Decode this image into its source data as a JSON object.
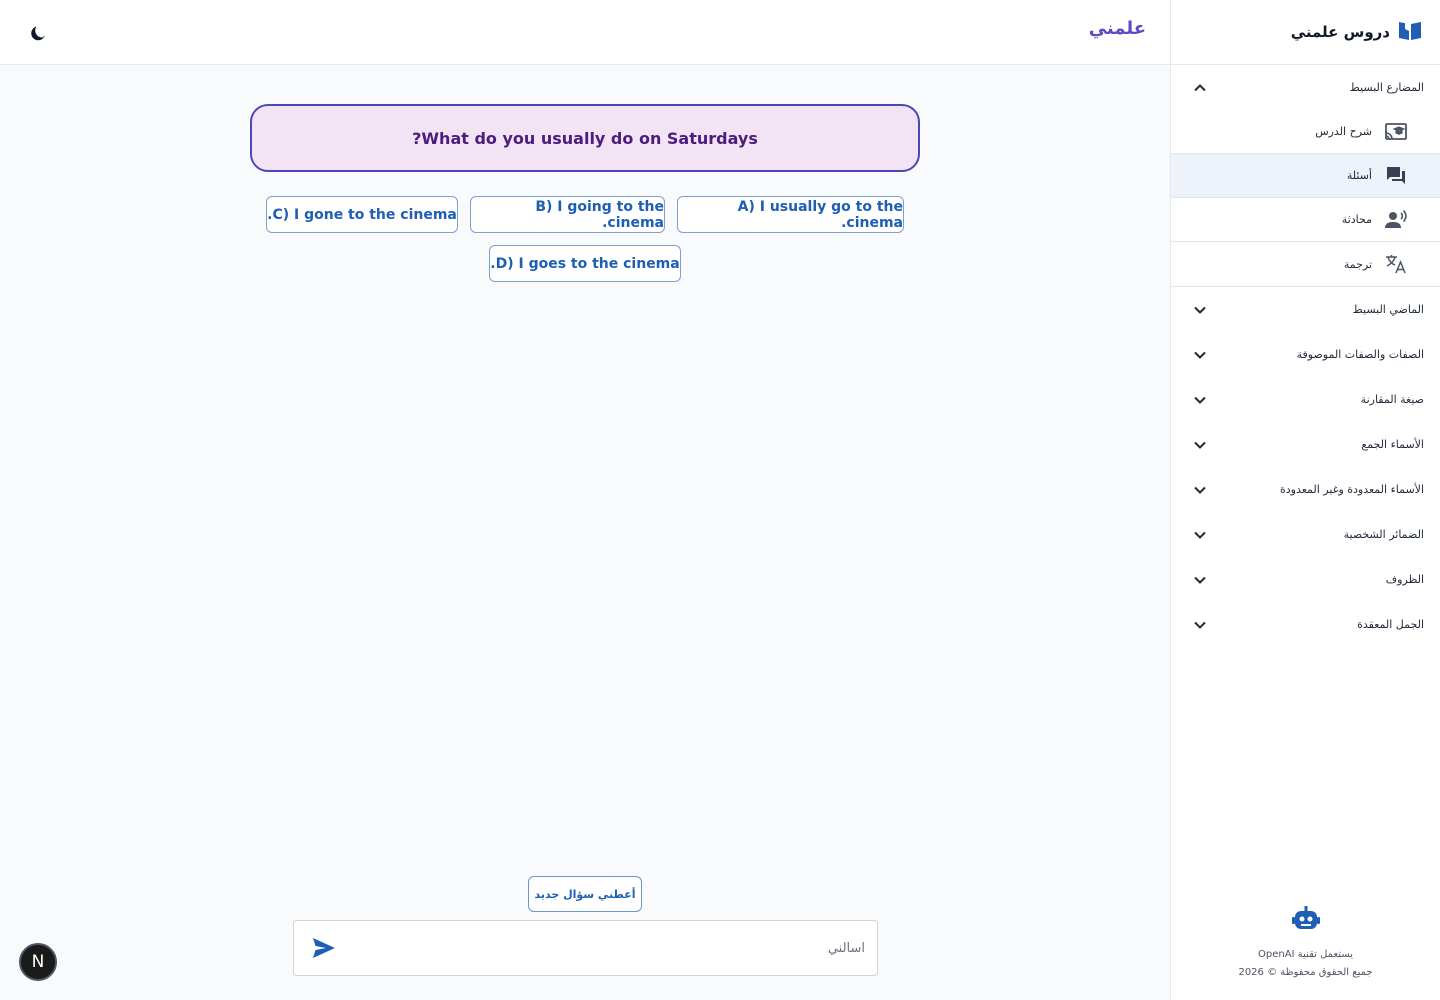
{
  "header": {
    "logo": "علمني",
    "theme_toggle_icon": "moon-icon"
  },
  "sidebar": {
    "title": "دروس علمني",
    "title_icon": "book-open-icon",
    "sections": [
      {
        "label": "المضارع البسيط",
        "expanded": true,
        "items": [
          {
            "label": "شرح الدرس",
            "icon": "cast-for-education-icon",
            "active": false
          },
          {
            "label": "أسئلة",
            "icon": "chat-bubbles-icon",
            "active": true
          },
          {
            "label": "محادثة",
            "icon": "voice-person-icon",
            "active": false
          },
          {
            "label": "ترجمة",
            "icon": "translate-icon",
            "active": false
          }
        ]
      },
      {
        "label": "الماضي البسيط",
        "expanded": false
      },
      {
        "label": "الصفات والصفات الموصوفة",
        "expanded": false
      },
      {
        "label": "صيغة المقارنة",
        "expanded": false
      },
      {
        "label": "الأسماء الجمع",
        "expanded": false
      },
      {
        "label": "الأسماء المعدودة وغير المعدودة",
        "expanded": false
      },
      {
        "label": "الضمائر الشخصية",
        "expanded": false
      },
      {
        "label": "الظروف",
        "expanded": false
      },
      {
        "label": "الجمل المعقدة",
        "expanded": false
      }
    ],
    "footer": {
      "icon": "robot-icon",
      "powered_by": "يستعمل تقنية OpenAI",
      "copyright": "جميع الحقوق محفوظة © 2026"
    }
  },
  "main": {
    "question": "What do you usually do on Saturdays?",
    "answers": [
      {
        "key": "A",
        "text": "A) I usually go to the cinema."
      },
      {
        "key": "B",
        "text": "B) I going to the cinema."
      },
      {
        "key": "C",
        "text": "C) I gone to the cinema."
      },
      {
        "key": "D",
        "text": "D) I goes to the cinema."
      }
    ],
    "new_question_button": "أعطني سؤال جديد",
    "input_placeholder": "اسألني",
    "send_icon": "send-icon"
  },
  "badge": {
    "letter": "N"
  },
  "colors": {
    "accent": "#1e5fb4",
    "question_border": "#4f46b5",
    "question_bg": "#f2e4f5",
    "active_item_bg": "#eef2fb",
    "logo": "#5b4cc4"
  }
}
